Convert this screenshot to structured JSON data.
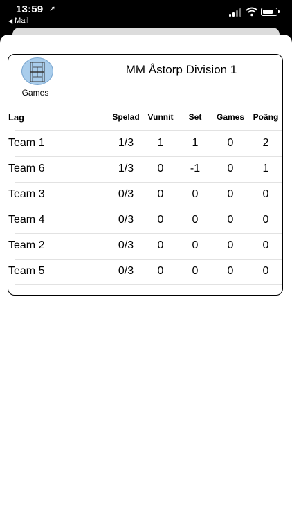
{
  "status_bar": {
    "time": "13:59",
    "back_label": "Mail"
  },
  "header": {
    "games_button_label": "Games",
    "title": "MM Åstorp Division 1"
  },
  "table": {
    "columns": [
      "Lag",
      "Spelad",
      "Vunnit",
      "Set",
      "Games",
      "Poäng"
    ],
    "rows": [
      [
        "Team 1",
        "1/3",
        "1",
        "1",
        "0",
        "2"
      ],
      [
        "Team 6",
        "1/3",
        "0",
        "-1",
        "0",
        "1"
      ],
      [
        "Team 3",
        "0/3",
        "0",
        "0",
        "0",
        "0"
      ],
      [
        "Team 4",
        "0/3",
        "0",
        "0",
        "0",
        "0"
      ],
      [
        "Team 2",
        "0/3",
        "0",
        "0",
        "0",
        "0"
      ],
      [
        "Team 5",
        "0/3",
        "0",
        "0",
        "0",
        "0"
      ]
    ]
  }
}
